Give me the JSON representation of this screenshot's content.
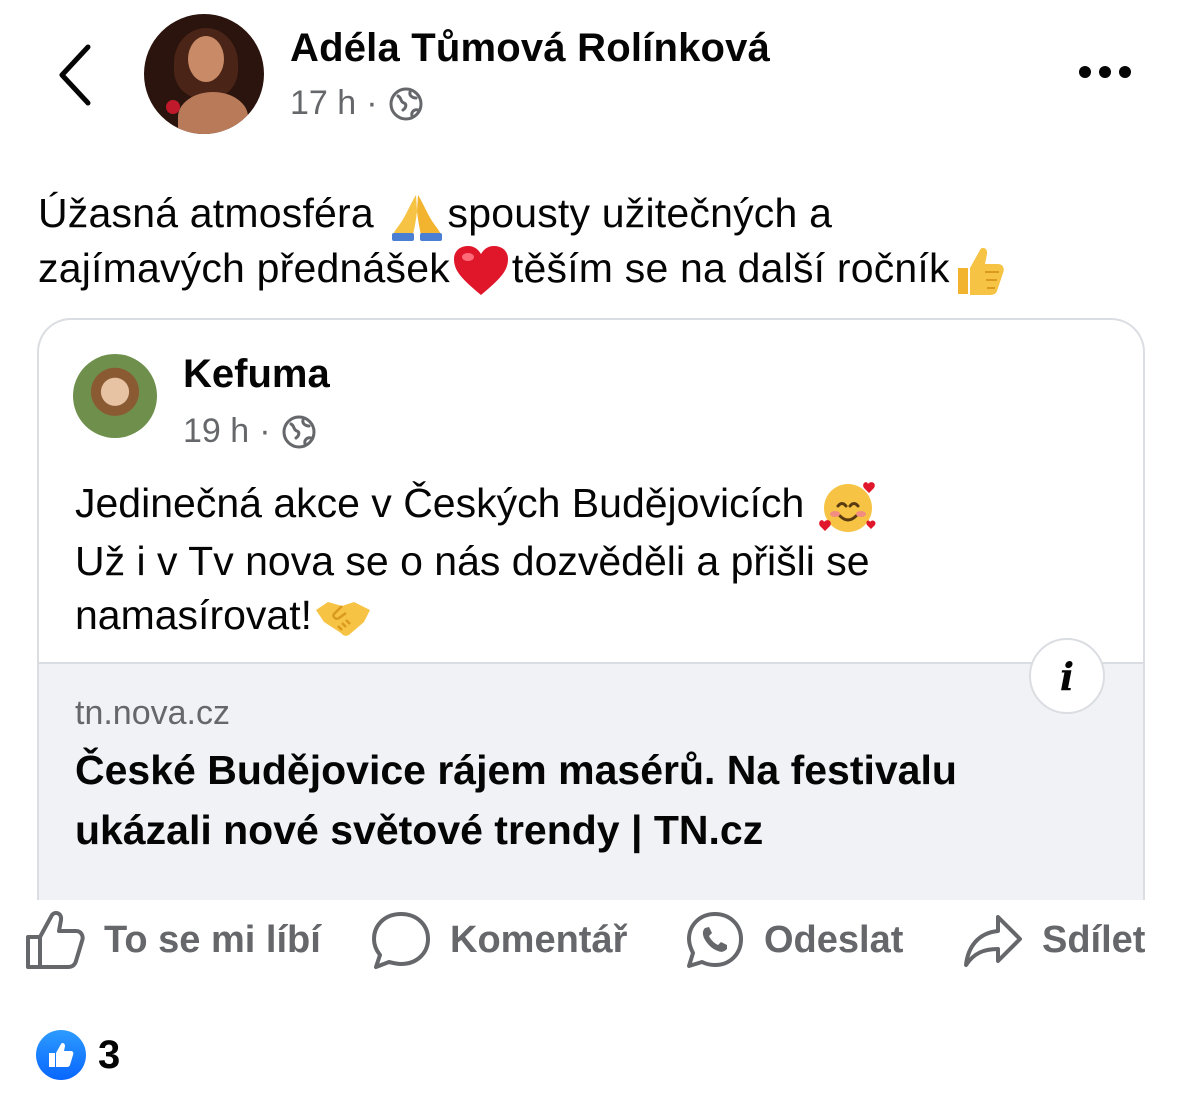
{
  "post": {
    "author": "Adéla Tůmová Rolínková",
    "time": "17 h",
    "separator": "·",
    "audience_icon": "globe-icon",
    "text_line1_a": "Úžasná atmosféra ",
    "text_line1_b": "spousty užitečných a",
    "text_line2_a": "zajímavých přednášek",
    "text_line2_b": "těším se na další ročník",
    "emojis": [
      "folded-hands",
      "red-heart",
      "thumbs-up"
    ]
  },
  "shared": {
    "author": "Kefuma",
    "time": "19 h",
    "separator": "·",
    "audience_icon": "globe-icon",
    "line1": "Jedinečná akce v Českých Budějovicích ",
    "line2": "Už i v Tv nova se o nás dozvěděli a přišli se",
    "line3": "namasírovat!",
    "emojis": [
      "smiling-face-with-hearts",
      "handshake"
    ]
  },
  "link": {
    "domain": "tn.nova.cz",
    "title": "České Budějovice rájem masérů. Na festivalu ukázali nové světové trendy | TN.cz",
    "info_label": "i"
  },
  "actions": {
    "like": "To se mi líbí",
    "comment": "Komentář",
    "send": "Odeslat",
    "share": "Sdílet"
  },
  "reactions": {
    "count": "3"
  },
  "colors": {
    "text": "#050505",
    "secondary": "#65676b",
    "border": "#dadde1",
    "preview_bg": "#f0f2f5",
    "like_blue": "#0866ff"
  }
}
